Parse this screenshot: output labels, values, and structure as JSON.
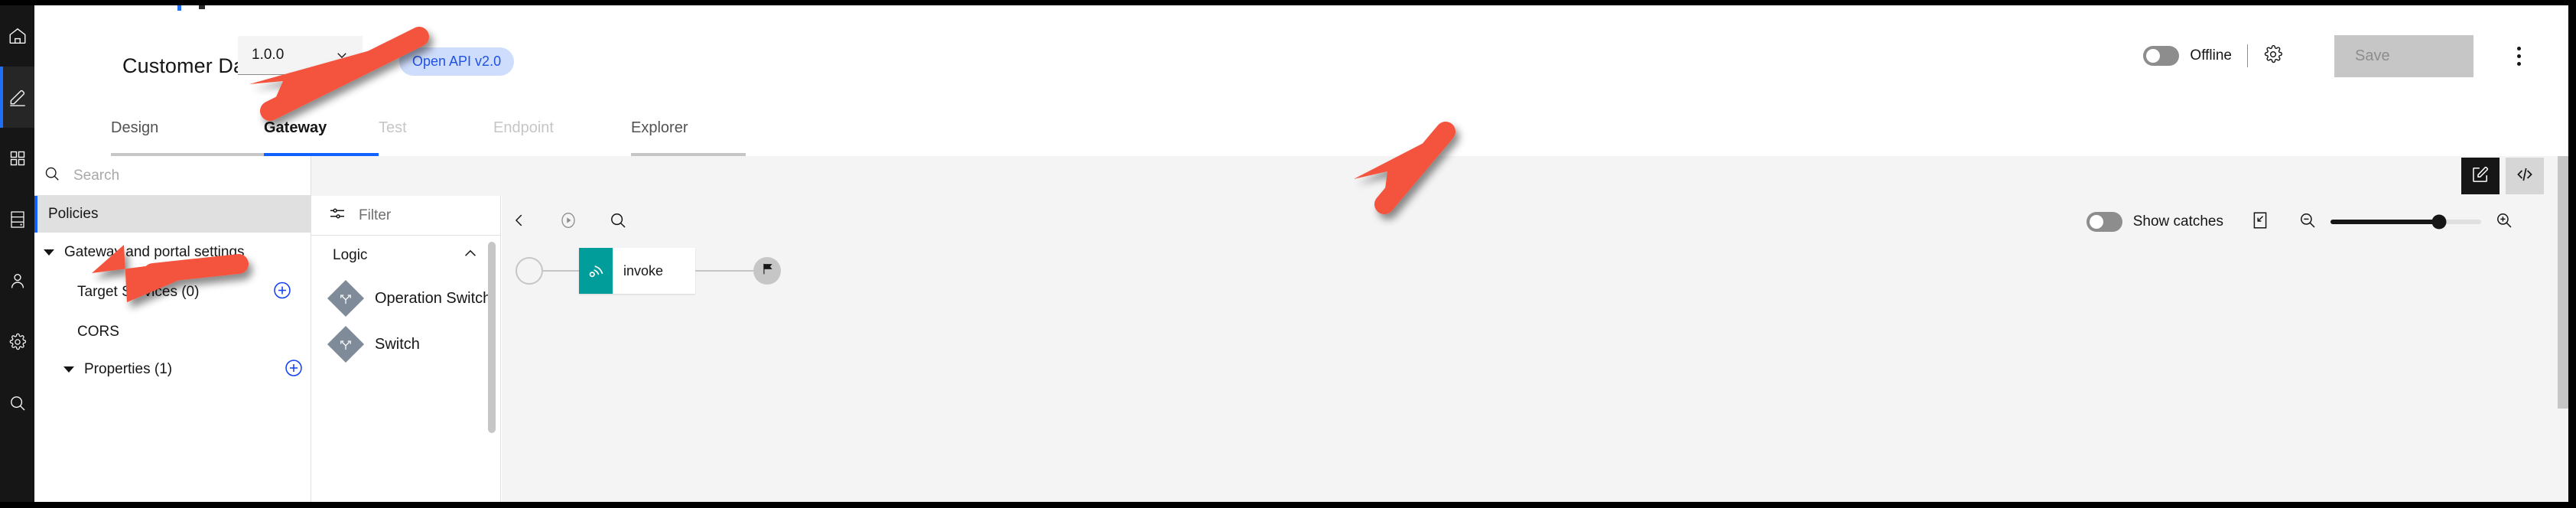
{
  "app": {
    "rail_items": [
      {
        "icon": "home-icon",
        "label": "Home",
        "active": false
      },
      {
        "icon": "pencil-icon",
        "label": "Design",
        "active": true
      },
      {
        "icon": "grid-apps-icon",
        "label": "Apps",
        "active": false
      },
      {
        "icon": "database-icon",
        "label": "Data",
        "active": false
      },
      {
        "icon": "user-icon",
        "label": "Users",
        "active": false
      },
      {
        "icon": "gear-icon",
        "label": "Settings",
        "active": false
      },
      {
        "icon": "search-icon",
        "label": "Search",
        "active": false
      }
    ]
  },
  "header": {
    "api_title": "Customer Database",
    "version": {
      "value": "1.0.0",
      "chevron_icon": "chevron-down-icon"
    },
    "spec_badge": "Open API v2.0",
    "offline_toggle": {
      "label": "Offline",
      "state": "off"
    },
    "settings_icon": "gear-icon",
    "save_label": "Save",
    "save_disabled": true,
    "overflow_icon": "kebab-menu-icon"
  },
  "tabs": [
    {
      "label": "Design",
      "state": "enabled"
    },
    {
      "label": "Gateway",
      "state": "active"
    },
    {
      "label": "Test",
      "state": "disabled"
    },
    {
      "label": "Endpoint",
      "state": "disabled"
    },
    {
      "label": "Explorer",
      "state": "enabled"
    }
  ],
  "explorer": {
    "search_placeholder": "Search",
    "search_icon": "search-icon",
    "selected_item": "Policies",
    "group_label": "Gateway and portal settings",
    "group_expanded": true,
    "sub_items": [
      {
        "label": "Target Services (0)",
        "has_add": true,
        "add_icon": "plus-circle-icon"
      },
      {
        "label": "CORS",
        "has_add": false
      }
    ],
    "next_group": {
      "label": "Properties (1)",
      "has_add": true,
      "add_icon": "plus-circle-icon",
      "expanded": true
    }
  },
  "stage": {
    "actions": [
      {
        "icon": "edit-pencil-square-icon",
        "name": "visual-editor",
        "active": true
      },
      {
        "icon": "code-brackets-icon",
        "name": "source-editor",
        "active": false
      }
    ]
  },
  "palette": {
    "filter_placeholder": "Filter",
    "filter_icon": "sliders-filter-icon",
    "groups": [
      {
        "label": "Logic",
        "expanded": true,
        "chevron_icon": "chevron-up-icon",
        "items": [
          {
            "label": "Operation Switch",
            "icon": "switch-branch-icon"
          },
          {
            "label": "Switch",
            "icon": "switch-branch-icon"
          }
        ]
      }
    ]
  },
  "canvas_toolbar": {
    "back_icon": "chevron-left-icon",
    "play_icon": "play-circle-icon",
    "search_icon": "search-icon",
    "show_catches": {
      "label": "Show catches",
      "state": "off"
    },
    "fit_icon": "fit-to-screen-icon",
    "zoom_out_icon": "zoom-out-icon",
    "zoom_in_icon": "zoom-in-icon",
    "zoom_percent": 72
  },
  "flow": {
    "start_node": {
      "name": "start-node",
      "icon": "circle-outline-icon"
    },
    "nodes": [
      {
        "label": "invoke",
        "icon": "invoke-api-icon",
        "color": "#009d9a"
      }
    ],
    "end_node": {
      "name": "end-node",
      "icon": "flag-icon"
    }
  },
  "annotations": [
    {
      "name": "arrow-to-gateway-tab",
      "color": "#f4533d",
      "points_at": "Gateway"
    },
    {
      "name": "arrow-to-policies",
      "color": "#f4533d",
      "points_at": "Policies"
    },
    {
      "name": "arrow-to-invoke-node",
      "color": "#f4533d",
      "points_at": "invoke"
    }
  ],
  "colors": {
    "accent_blue": "#0f62fe",
    "badge_bg": "#cfddfd",
    "badge_text": "#1f52e0",
    "teal_node": "#009d9a",
    "annotation_red": "#f4533d",
    "rail_bg": "#161616",
    "stage_bg": "#f4f4f4"
  }
}
